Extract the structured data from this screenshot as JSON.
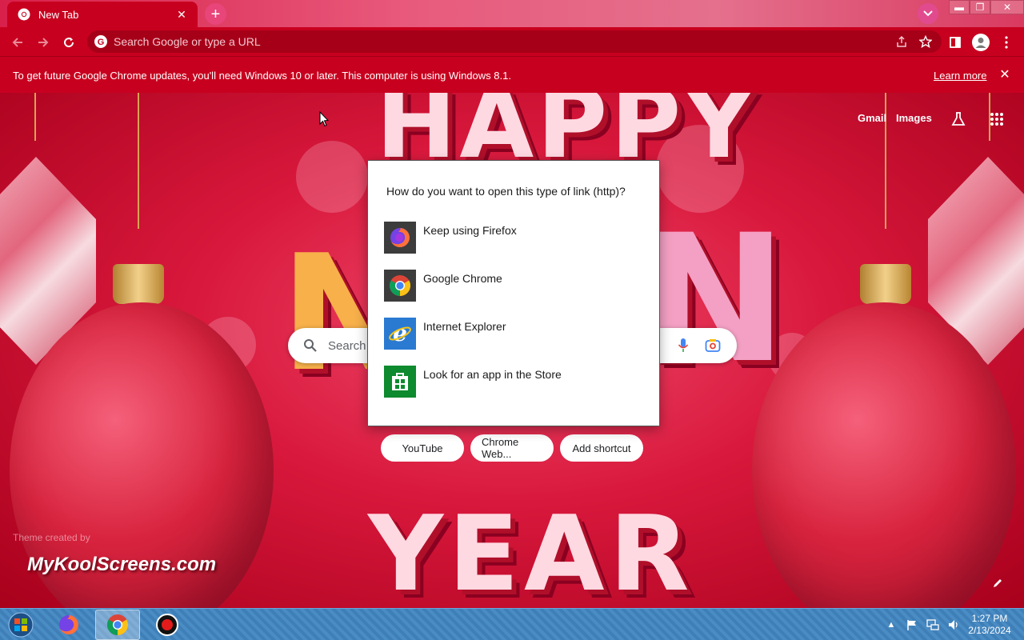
{
  "browser": {
    "tab_title": "New Tab",
    "tab_close": "✕",
    "new_tab": "+",
    "omnibox_placeholder": "Search Google or type a URL"
  },
  "window_controls": {
    "minimize": "▬",
    "restore": "❐",
    "close": "✕"
  },
  "infobar": {
    "message": "To get future Google Chrome updates, you'll need Windows 10 or later. This computer is using Windows 8.1.",
    "learn_more": "Learn more",
    "close": "✕"
  },
  "ntp": {
    "gmail": "Gmail",
    "images": "Images",
    "search_placeholder": "Search Google or type a URL",
    "search_visible": "Search",
    "shortcuts": [
      {
        "label": "YouTube"
      },
      {
        "label": "Chrome Web..."
      },
      {
        "label": "Add shortcut"
      }
    ],
    "theme_credit_small": "Theme created by",
    "theme_credit_big": "MyKoolScreens.com",
    "background_letters": {
      "top": "HAPPY",
      "bottom": "YEAR",
      "left": "N",
      "right": "N"
    }
  },
  "dialog": {
    "title": "How do you want to open this type of link (http)?",
    "options": [
      {
        "label": "Keep using Firefox",
        "icon": "firefox-icon"
      },
      {
        "label": "Google Chrome",
        "icon": "chrome-icon"
      },
      {
        "label": "Internet Explorer",
        "icon": "internet-explorer-icon"
      },
      {
        "label": "Look for an app in the Store",
        "icon": "store-icon"
      }
    ]
  },
  "taskbar": {
    "clock_time": "1:27 PM",
    "clock_date": "2/13/2024",
    "tray_arrow": "▲"
  },
  "colors": {
    "chrome_red": "#c8001f",
    "omnibox": "#a60018",
    "taskbar": "#3f7fb8"
  }
}
